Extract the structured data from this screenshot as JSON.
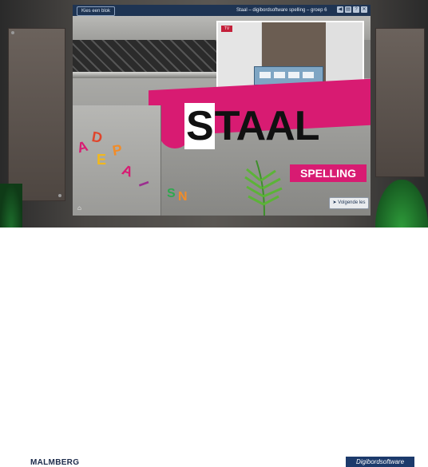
{
  "topbar": {
    "pick_button": "Kies een blok",
    "title": "Staal – digibordsoftware spelling – groep 6",
    "icons": [
      "prev-icon",
      "book-icon",
      "help-icon",
      "close-icon"
    ],
    "icon_glyphs": [
      "◀",
      "▤",
      "?",
      "✕"
    ]
  },
  "video": {
    "logo_text": "TV"
  },
  "hero": {
    "title_s": "S",
    "title_rest": "TAAL",
    "subtitle": "SPELLING"
  },
  "letters": [
    "A",
    "D",
    "E",
    "P",
    "A",
    "I",
    "S",
    "N"
  ],
  "letter_colors": [
    "#d81b72",
    "#e0452b",
    "#f2b81c",
    "#f28c28",
    "#d81b72",
    "#9b2f8f",
    "#2fa84f",
    "#f28c28"
  ],
  "nav": {
    "next_label": "Volgende les",
    "home_label": "⌂"
  },
  "footer": {
    "brand_left": "MALMBERG",
    "brand_right": "Digibordsoftware"
  },
  "colors": {
    "accent": "#d81b72",
    "topbar": "#1e3453",
    "brand_right_bg": "#1c3a6b"
  }
}
